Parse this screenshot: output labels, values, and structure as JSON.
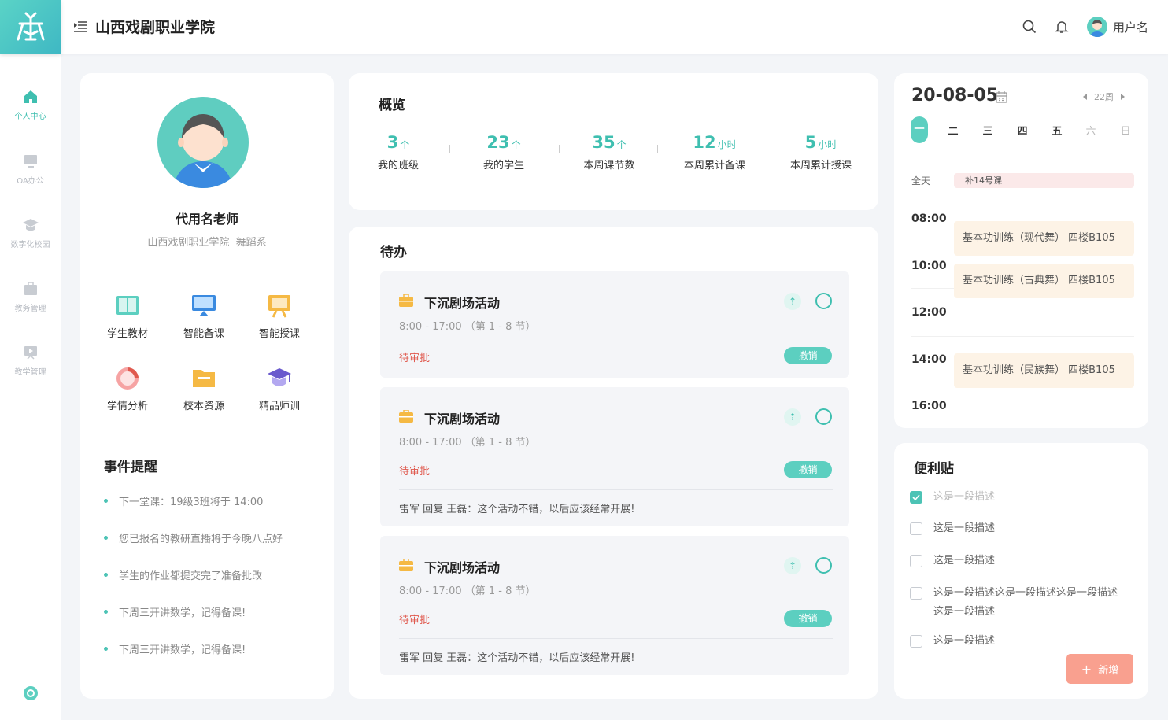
{
  "header": {
    "title": "山西戏剧职业学院",
    "username": "用户名"
  },
  "sidebar": {
    "items": [
      {
        "label": "个人中心",
        "active": true
      },
      {
        "label": "OA办公",
        "active": false
      },
      {
        "label": "数字化校园",
        "active": false
      },
      {
        "label": "教务管理",
        "active": false
      },
      {
        "label": "教学管理",
        "active": false
      }
    ],
    "oa_icon_text": "OA"
  },
  "profile": {
    "name": "代用名老师",
    "school": "山西戏剧职业学院",
    "dept": "舞蹈系",
    "tiles": [
      "学生教材",
      "智能备课",
      "智能授课",
      "学情分析",
      "校本资源",
      "精品师训"
    ],
    "events_title": "事件提醒",
    "events": [
      "下一堂课：19级3班将于 14:00",
      "您已报名的教研直播将于今晚八点好",
      "学生的作业都提交完了准备批改",
      "下周三开讲数学，记得备课!",
      "下周三开讲数学，记得备课!"
    ]
  },
  "overview": {
    "title": "概览",
    "stats": [
      {
        "value": "3",
        "unit": "个",
        "label": "我的班级"
      },
      {
        "value": "23",
        "unit": "个",
        "label": "我的学生"
      },
      {
        "value": "35",
        "unit": "个",
        "label": "本周课节数"
      },
      {
        "value": "12",
        "unit": "小时",
        "label": "本周累计备课"
      },
      {
        "value": "5",
        "unit": "小时",
        "label": "本周累计授课"
      }
    ]
  },
  "todo": {
    "title": "待办",
    "items": [
      {
        "title": "下沉剧场活动",
        "time": "8:00 - 17:00  （第 1 - 8 节）",
        "status": "待审批",
        "cancel": "撤销",
        "pin": "⇡",
        "comment": ""
      },
      {
        "title": "下沉剧场活动",
        "time": "8:00 - 17:00  （第 1 - 8 节）",
        "status": "待审批",
        "cancel": "撤销",
        "pin": "⇡",
        "comment": "雷军  回复  王磊：这个活动不错，以后应该经常开展!"
      },
      {
        "title": "下沉剧场活动",
        "time": "8:00 - 17:00  （第 1 - 8 节）",
        "status": "待审批",
        "cancel": "撤销",
        "pin": "⇡",
        "comment": "雷军  回复  王磊：这个活动不错，以后应该经常开展!"
      }
    ]
  },
  "calendar": {
    "date": "20-08-05",
    "week": "22周",
    "weekdays": [
      "一",
      "二",
      "三",
      "四",
      "五",
      "六",
      "日"
    ],
    "allday_label": "全天",
    "allday_event": "补14号课",
    "times": [
      "08:00",
      "10:00",
      "12:00",
      "14:00",
      "16:00"
    ],
    "events": [
      "基本功训练（现代舞）   四楼B105",
      "基本功训练（古典舞）   四楼B105",
      "基本功训练（民族舞）   四楼B105"
    ]
  },
  "sticky": {
    "title": "便利贴",
    "notes": [
      {
        "text": "这是一段描述",
        "done": true
      },
      {
        "text": "这是一段描述",
        "done": false
      },
      {
        "text": "这是一段描述",
        "done": false
      },
      {
        "text": "这是一段描述这是一段描述这是一段描述这是一段描述",
        "done": false
      },
      {
        "text": "这是一段描述",
        "done": false
      }
    ],
    "add_label": "新增",
    "add_plus": "+"
  },
  "colors": {
    "accent": "#3fbfb0",
    "danger": "#e05a4f",
    "add": "#f9a08f"
  }
}
